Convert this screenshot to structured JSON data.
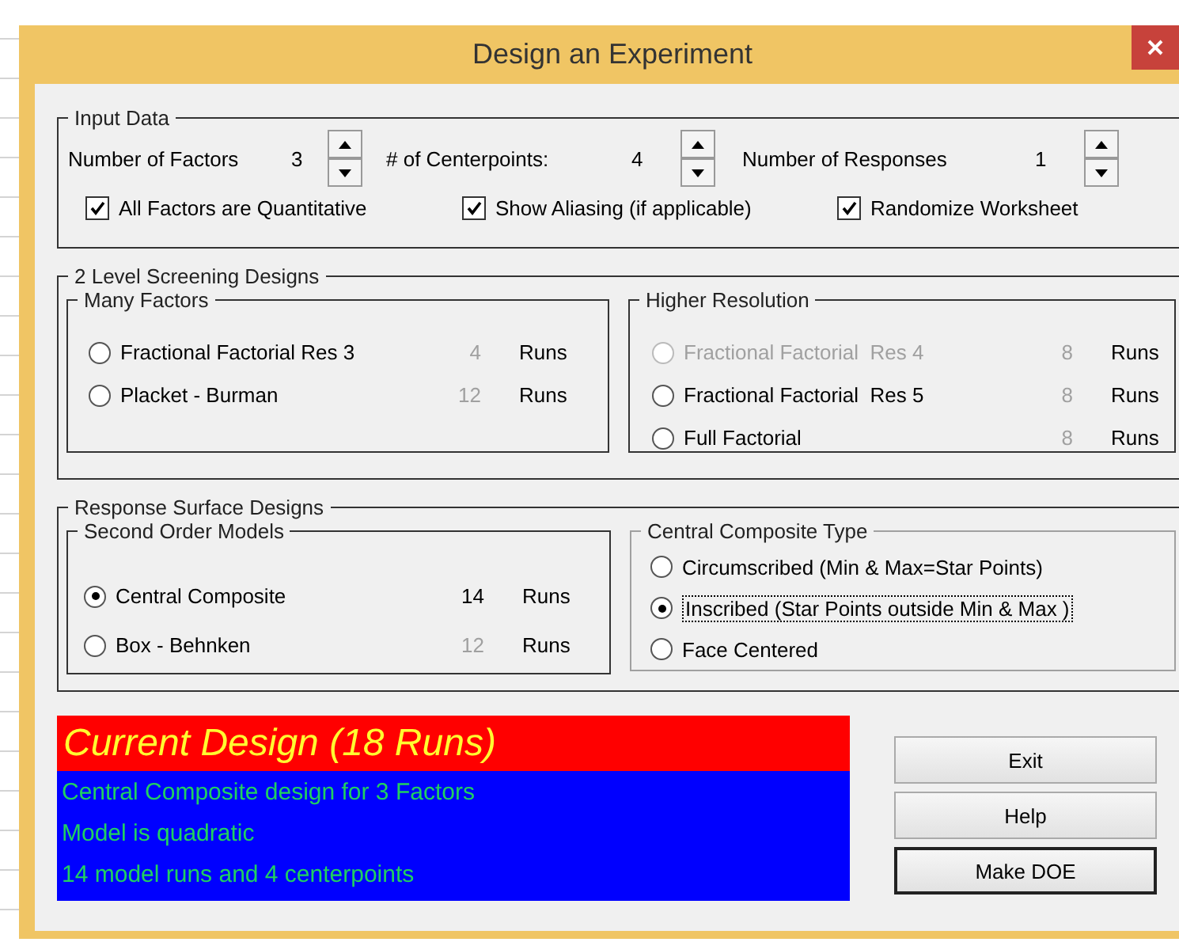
{
  "window": {
    "title": "Design an Experiment"
  },
  "input_data": {
    "legend": "Input Data",
    "spinners": [
      {
        "label": "Number of Factors",
        "value": "3"
      },
      {
        "label": "# of Centerpoints:",
        "value": "4"
      },
      {
        "label": "Number of Responses",
        "value": "1"
      }
    ],
    "checkboxes": [
      {
        "label": "All Factors are Quantitative",
        "checked": true
      },
      {
        "label": "Show Aliasing (if applicable)",
        "checked": true
      },
      {
        "label": "Randomize Worksheet",
        "checked": true
      }
    ]
  },
  "screening": {
    "legend": "2 Level Screening Designs",
    "groups": [
      {
        "legend": "Many Factors",
        "options": [
          {
            "label": "Fractional Factorial Res 3",
            "runs": "4",
            "unit": "Runs",
            "selected": false,
            "disabled": false,
            "runs_active": false
          },
          {
            "label": "Placket - Burman",
            "runs": "12",
            "unit": "Runs",
            "selected": false,
            "disabled": false,
            "runs_active": false
          }
        ]
      },
      {
        "legend": "Higher Resolution",
        "options": [
          {
            "label": "Fractional Factorial  Res 4",
            "runs": "8",
            "unit": "Runs",
            "selected": false,
            "disabled": true,
            "runs_active": false
          },
          {
            "label": "Fractional Factorial  Res 5",
            "runs": "8",
            "unit": "Runs",
            "selected": false,
            "disabled": false,
            "runs_active": false
          },
          {
            "label": "Full Factorial",
            "runs": "8",
            "unit": "Runs",
            "selected": false,
            "disabled": false,
            "runs_active": false
          }
        ]
      }
    ]
  },
  "response_surface": {
    "legend": "Response Surface Designs",
    "models": {
      "legend": "Second Order Models",
      "options": [
        {
          "label": "Central Composite",
          "runs": "14",
          "unit": "Runs",
          "selected": true,
          "disabled": false,
          "runs_active": true
        },
        {
          "label": "Box - Behnken",
          "runs": "12",
          "unit": "Runs",
          "selected": false,
          "disabled": false,
          "runs_active": false
        }
      ]
    },
    "cc_type": {
      "legend": "Central Composite Type",
      "options": [
        {
          "label": "Circumscribed (Min & Max=Star Points)",
          "selected": false,
          "focused": false
        },
        {
          "label": "Inscribed (Star Points outside Min & Max )",
          "selected": true,
          "focused": true
        },
        {
          "label": "Face Centered",
          "selected": false,
          "focused": false
        }
      ]
    }
  },
  "summary": {
    "title": "Current Design (18 Runs)",
    "lines": [
      "Central Composite design for 3 Factors",
      "Model is quadratic",
      "14 model runs and 4 centerpoints"
    ]
  },
  "buttons": [
    {
      "label": "Exit",
      "default": false
    },
    {
      "label": "Help",
      "default": false
    },
    {
      "label": "Make DOE",
      "default": true
    }
  ]
}
